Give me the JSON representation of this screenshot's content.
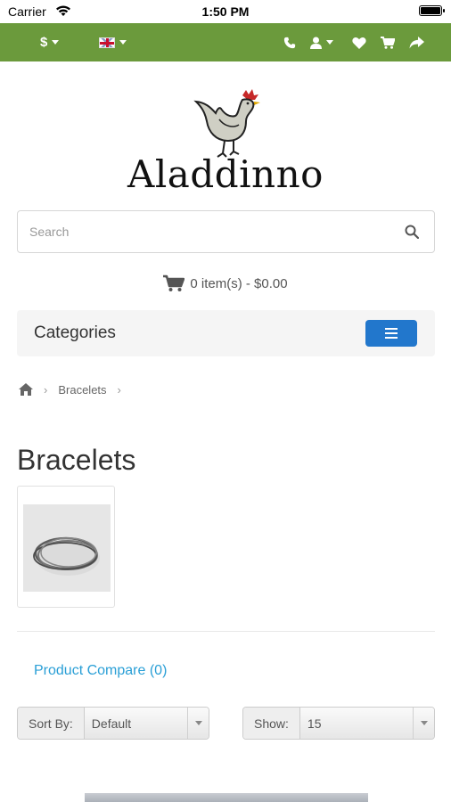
{
  "status_bar": {
    "carrier": "Carrier",
    "time": "1:50 PM"
  },
  "top_bar": {
    "currency_symbol": "$",
    "language_flag": "uk-flag-icon",
    "icons": [
      "phone-icon",
      "user-icon",
      "heart-icon",
      "cart-icon",
      "share-icon"
    ],
    "background": "#6b9a3c"
  },
  "logo": {
    "text": "Aladdinno"
  },
  "search": {
    "placeholder": "Search"
  },
  "cart": {
    "summary": "0 item(s) - $0.00"
  },
  "categories": {
    "title": "Categories",
    "menu_button_color": "#2277cc"
  },
  "breadcrumb": {
    "items": [
      "Bracelets"
    ]
  },
  "page": {
    "title": "Bracelets"
  },
  "product_compare": {
    "label": "Product Compare (0)"
  },
  "sort": {
    "label": "Sort By:",
    "value": "Default"
  },
  "show": {
    "label": "Show:",
    "value": "15"
  }
}
